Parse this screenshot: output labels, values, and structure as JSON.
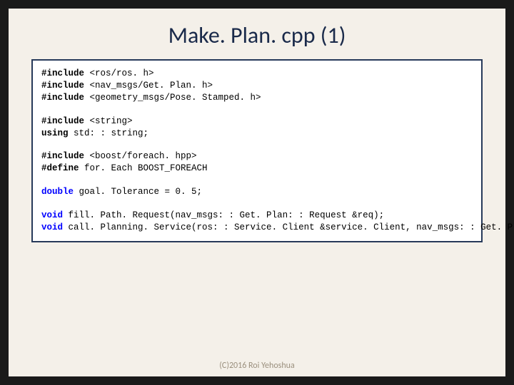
{
  "title": "Make. Plan. cpp (1)",
  "code": {
    "l1a": "#include",
    "l1b": " <ros/ros. h>",
    "l2a": "#include",
    "l2b": " <nav_msgs/Get. Plan. h>",
    "l3a": "#include",
    "l3b": " <geometry_msgs/Pose. Stamped. h>",
    "l4a": "#include",
    "l4b": " <string>",
    "l5a": "using",
    "l5b": " std: : string;",
    "l6a": "#include",
    "l6b": " <boost/foreach. hpp>",
    "l7a": "#define",
    "l7b": " for. Each BOOST_FOREACH",
    "l8a": "double",
    "l8b": " goal. Tolerance = 0. 5;",
    "l9a": "void",
    "l9b": " fill. Path. Request(nav_msgs: : Get. Plan: : Request &req);",
    "l10a": "void",
    "l10b": " call. Planning. Service(ros: : Service. Client &service. Client, nav_msgs: : Get. Plan &srv);"
  },
  "footer": "(C)2016 Roi Yehoshua"
}
